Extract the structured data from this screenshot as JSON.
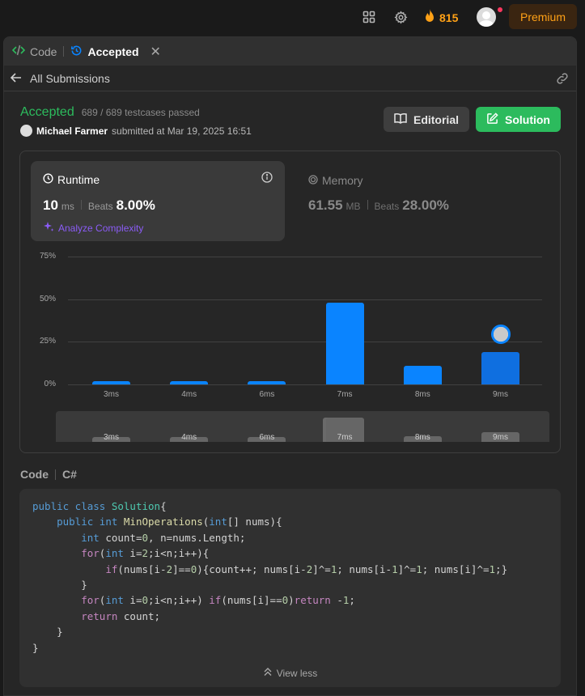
{
  "topbar": {
    "streak_count": "815",
    "premium_label": "Premium",
    "icons": [
      "grid-icon",
      "gear-icon",
      "fire-icon",
      "user-avatar"
    ],
    "accent_color": "#ffa116"
  },
  "tabs": [
    {
      "label": "Code",
      "icon": "code-icon",
      "active": false
    },
    {
      "label": "Accepted",
      "icon": "history-icon",
      "active": true,
      "closable": true
    }
  ],
  "subbar": {
    "back_label": "All Submissions"
  },
  "submission": {
    "status": "Accepted",
    "status_color": "#2cbb5d",
    "testcases": "689 / 689 testcases passed",
    "user": "Michael Farmer",
    "submitted_text": "submitted at Mar 19, 2025 16:51",
    "editorial_label": "Editorial",
    "solution_label": "Solution"
  },
  "runtime": {
    "title": "Runtime",
    "value": "10",
    "unit": "ms",
    "beats_label": "Beats",
    "beats_pct": "8.00%",
    "analyze_label": "Analyze Complexity"
  },
  "memory": {
    "title": "Memory",
    "value": "61.55",
    "unit": "MB",
    "beats_label": "Beats",
    "beats_pct": "28.00%"
  },
  "chart_data": {
    "type": "bar",
    "categories": [
      "3ms",
      "4ms",
      "6ms",
      "7ms",
      "8ms",
      "9ms"
    ],
    "values": [
      2,
      2,
      2,
      48,
      11,
      19
    ],
    "y_ticks": [
      "75%",
      "50%",
      "25%",
      "0%"
    ],
    "ylim": [
      0,
      75
    ],
    "highlighted_category": "9ms",
    "bar_color": "#0a84ff",
    "title": "",
    "xlabel": "",
    "ylabel": ""
  },
  "code_section": {
    "label": "Code",
    "language": "C#",
    "view_less_label": "View less"
  }
}
